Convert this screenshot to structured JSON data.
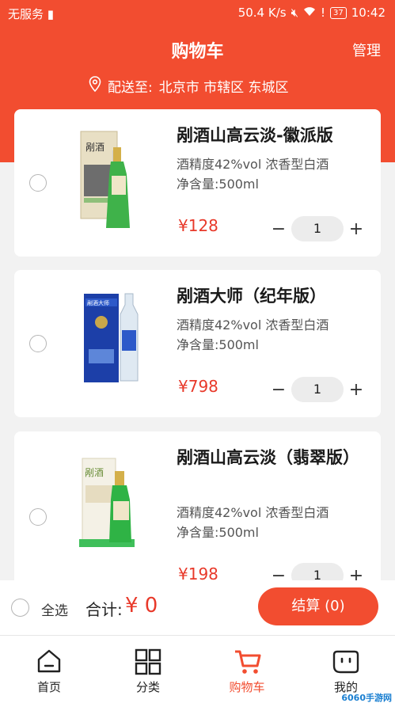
{
  "status_bar": {
    "carrier": "无服务",
    "speed": "50.4 K/s",
    "battery": "37",
    "time": "10:42"
  },
  "header": {
    "title": "购物车",
    "manage_label": "管理",
    "address_prefix": "配送至:",
    "address": "北京市 市辖区 东城区"
  },
  "cart": {
    "items": [
      {
        "name": "剐酒山高云淡-徽派版",
        "spec_line1": "酒精度42%vol 浓香型白酒",
        "spec_line2": "净含量:500ml",
        "price": "¥128",
        "quantity": "1"
      },
      {
        "name": "剐酒大师（纪年版）",
        "spec_line1": "酒精度42%vol 浓香型白酒",
        "spec_line2": "净含量:500ml",
        "price": "¥798",
        "quantity": "1"
      },
      {
        "name": "剐酒山高云淡（翡翠版）",
        "spec_line1": "酒精度42%vol 浓香型白酒",
        "spec_line2": "净含量:500ml",
        "price": "¥198",
        "quantity": "1"
      }
    ]
  },
  "checkout": {
    "select_all_label": "全选",
    "total_label": "合计:",
    "total_value": "¥ 0",
    "checkout_button": "结算 (0)"
  },
  "tabbar": {
    "tabs": [
      {
        "label": "首页",
        "icon": "home-icon"
      },
      {
        "label": "分类",
        "icon": "grid-icon"
      },
      {
        "label": "购物车",
        "icon": "cart-icon"
      },
      {
        "label": "我的",
        "icon": "profile-icon"
      }
    ]
  },
  "watermark": "6060手游网",
  "colors": {
    "primary": "#f24d30",
    "price": "#e8392a",
    "background": "#f2f2f2"
  }
}
